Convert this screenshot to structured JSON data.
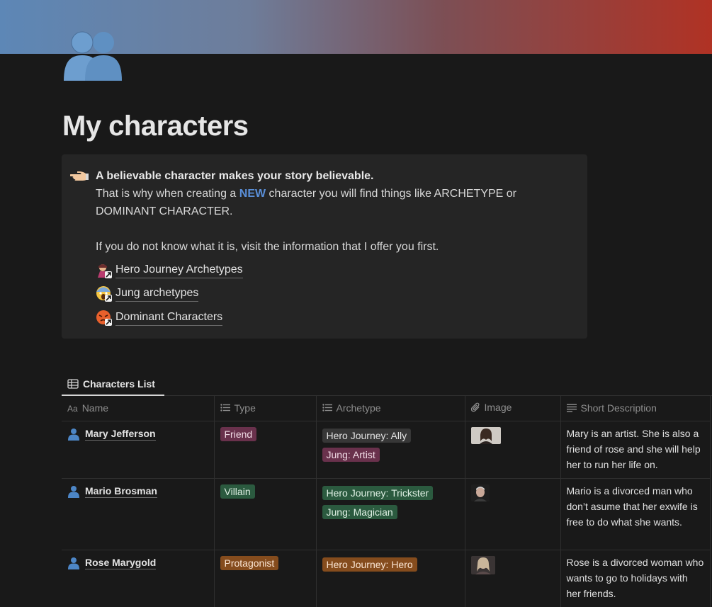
{
  "page": {
    "title": "My characters",
    "icon": "busts-in-silhouette-icon",
    "cover_colors": [
      "#5d87b6",
      "#b03224"
    ]
  },
  "callout": {
    "icon": "pointing-hand-icon",
    "headline": "A believable character makes your story believable.",
    "line2_before": "That is why when creating a ",
    "line2_highlight": "NEW",
    "line2_after": " character you will find things like ARCHETYPE or DOMINANT CHARACTER.",
    "line3": "If you do not know what it is, visit the information that I offer you first.",
    "links": [
      {
        "icon": "superhero-icon",
        "label": "Hero Journey Archetypes"
      },
      {
        "icon": "screaming-face-icon",
        "label": "Jung archetypes"
      },
      {
        "icon": "angry-face-icon",
        "label": "Dominant Characters"
      }
    ]
  },
  "view": {
    "tab_label": "Characters List",
    "tab_icon": "table-icon"
  },
  "table": {
    "columns": [
      {
        "icon": "Aa",
        "label": "Name"
      },
      {
        "icon": "list-icon",
        "label": "Type"
      },
      {
        "icon": "list-icon",
        "label": "Archetype"
      },
      {
        "icon": "paperclip-icon",
        "label": "Image"
      },
      {
        "icon": "text-lines-icon",
        "label": "Short Description"
      }
    ],
    "rows": [
      {
        "name": "Mary Jefferson",
        "type": "Friend",
        "archetypes": [
          "Hero Journey: Ally",
          "Jung: Artist"
        ],
        "description": "Mary is an artist. She is also a friend of rose and she will help her to run her life on."
      },
      {
        "name": "Mario Brosman",
        "type": "Villain",
        "archetypes": [
          "Hero Journey: Trickster",
          "Jung: Magician"
        ],
        "description": "Mario is a divorced man who don’t asume that her exwife is free to do what she wants."
      },
      {
        "name": "Rose Marygold",
        "type": "Protagonist",
        "archetypes": [
          "Hero Journey: Hero"
        ],
        "description": "Rose is a divorced woman who wants to go to holidays with her friends."
      }
    ]
  }
}
